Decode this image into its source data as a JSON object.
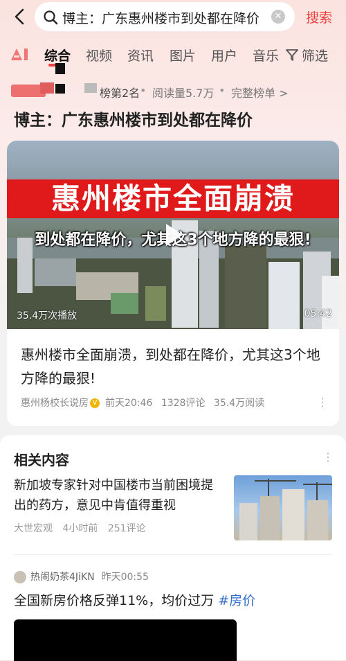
{
  "search": {
    "query": "博主：广东惠州楼市到处都在降价",
    "button_label": "搜索"
  },
  "tabs": [
    {
      "label": "综合",
      "active": true
    },
    {
      "label": "视频"
    },
    {
      "label": "资讯"
    },
    {
      "label": "图片"
    },
    {
      "label": "用户"
    },
    {
      "label": "音乐"
    },
    {
      "label": "筛选"
    }
  ],
  "rank": {
    "position": "榜第2名",
    "reads": "阅读量5.7万",
    "full_list": "完整榜单 >"
  },
  "page_title": "博主：广东惠州楼市到处都在降价",
  "main_card": {
    "overlay_title": "惠州楼市全面崩溃",
    "overlay_subtitle": "到处都在降价，尤其这3个地方降的最狠!",
    "plays": "35.4万次播放",
    "duration": "05:42",
    "title": "惠州楼市全面崩溃，到处都在降价，尤其这3个地方降的最狠!",
    "author": "惠州杨校长说房",
    "time": "前天20:46",
    "comments": "1328评论",
    "reads": "35.4万阅读"
  },
  "related": {
    "title": "相关内容",
    "item1": {
      "title": "新加坡专家针对中国楼市当前困境提出的药方，意见中肯值得重视",
      "source": "大世宏观",
      "time": "4小时前",
      "comments": "251评论"
    },
    "item2": {
      "author": "热闹奶茶4JiKN",
      "time": "昨天00:55",
      "text": "全国新房价格反弹11%，均价过万 ",
      "hashtag": "#房价"
    }
  },
  "colors": {
    "accent": "#ee3f3f",
    "link": "#3471cf"
  }
}
